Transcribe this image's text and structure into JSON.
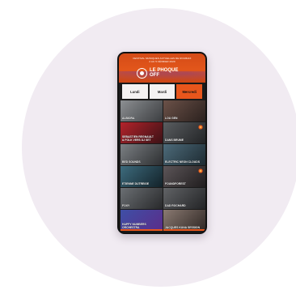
{
  "app": {
    "festival_line_1": "FESTIVAL MUSIQUES ACTUELLES DE ROUBAIX",
    "festival_line_2": "2 AU 5 FÉVRIER 2020",
    "logo_line_1": "LE PHOQUE",
    "logo_line_2": "OFF",
    "accent_color": "#e8561c"
  },
  "tabs": [
    {
      "label": "Lundi",
      "active": false
    },
    {
      "label": "Mardi",
      "active": false
    },
    {
      "label": "Mercredi",
      "active": true
    }
  ],
  "artists": [
    {
      "label": "ALBIORA"
    },
    {
      "label": "LOU GEN"
    },
    {
      "label": "SEBASTIEN REGNAULT\n& FOLK VERS DJ SET"
    },
    {
      "label": "DANS BRUME"
    },
    {
      "label": "BED SOUNDS"
    },
    {
      "label": "ELECTRIC NEON CLOUDS"
    },
    {
      "label": "ETIENNE DUTREIGE"
    },
    {
      "label": "FOUNDFOREST"
    },
    {
      "label": "FOXY"
    },
    {
      "label": "DAD ROCHARD"
    },
    {
      "label": "HAPPY NUMBERS\nORCHESTRA"
    },
    {
      "label": "JACQUES KUNA SESSION"
    }
  ]
}
